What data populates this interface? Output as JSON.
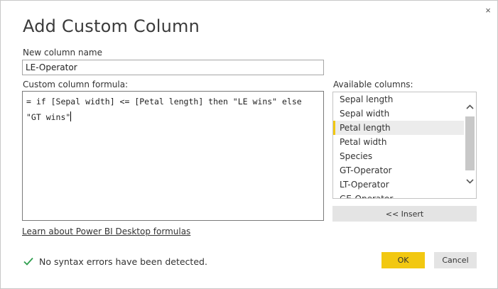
{
  "dialog": {
    "title": "Add Custom Column",
    "close_glyph": "×"
  },
  "new_column": {
    "label": "New column name",
    "value": "LE-Operator"
  },
  "formula": {
    "label": "Custom column formula:",
    "value": "= if [Sepal width] <= [Petal length] then \"LE wins\" else \"GT wins\""
  },
  "available": {
    "label": "Available columns:",
    "items": [
      "Sepal length",
      "Sepal width",
      "Petal length",
      "Petal width",
      "Species",
      "GT-Operator",
      "LT-Operator",
      "GE-Operator"
    ],
    "selected": "Petal length",
    "scroll_up_icon": "chevron-up-icon",
    "scroll_down_icon": "chevron-down-icon"
  },
  "insert_button": "<< Insert",
  "learn_link": "Learn about Power BI Desktop formulas",
  "status": {
    "icon": "check-icon",
    "text": "No syntax errors have been detected.",
    "color": "#2e9e4e"
  },
  "buttons": {
    "ok": "OK",
    "cancel": "Cancel",
    "accent": "#f2c811"
  }
}
